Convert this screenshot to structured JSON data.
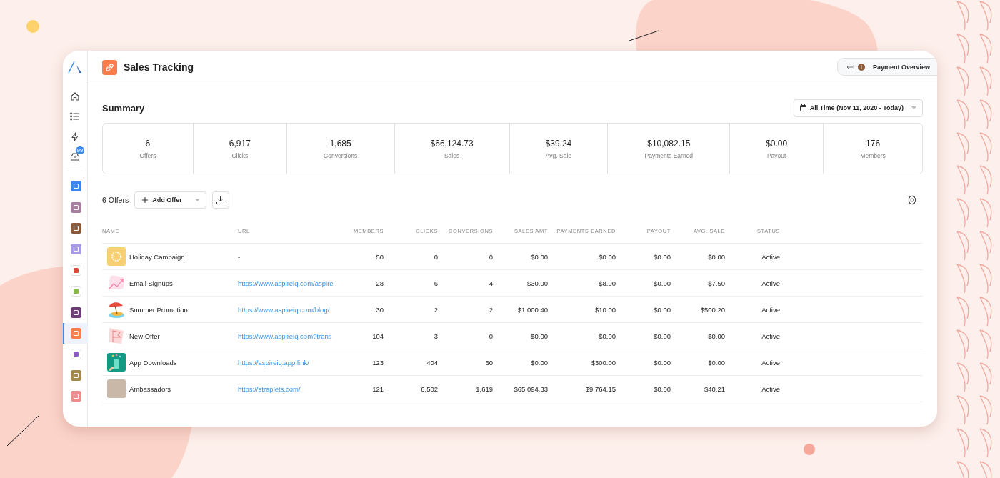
{
  "sidebar": {
    "nav": [
      {
        "kind": "home",
        "selected": false
      },
      {
        "kind": "list",
        "selected": false
      },
      {
        "kind": "bolt",
        "selected": false
      },
      {
        "kind": "inbox",
        "selected": false,
        "badge": "99"
      }
    ],
    "apps": [
      {
        "kind": "filled",
        "color": "#3d86f0",
        "selected": false
      },
      {
        "kind": "filled",
        "color": "#a77e9f",
        "selected": false
      },
      {
        "kind": "filled",
        "color": "#8a5a3b",
        "selected": false
      },
      {
        "kind": "filled",
        "color": "#a99ae8",
        "selected": false
      },
      {
        "kind": "outlined",
        "color": "#e0463a",
        "selected": false
      },
      {
        "kind": "outlined",
        "color": "#86b94a",
        "selected": false
      },
      {
        "kind": "filled",
        "color": "#6d3a78",
        "selected": false
      },
      {
        "kind": "filled",
        "color": "#fa7b4c",
        "selected": true
      },
      {
        "kind": "outlined",
        "color": "#8a5cc4",
        "selected": false
      },
      {
        "kind": "filled",
        "color": "#a4894b",
        "selected": false
      },
      {
        "kind": "filled",
        "color": "#ec8c8c",
        "selected": false
      }
    ]
  },
  "header": {
    "title": "Sales Tracking",
    "payment_button": "Payment Overview"
  },
  "summary": {
    "title": "Summary",
    "date_range": "All Time (Nov 11, 2020 - Today)",
    "stats": [
      {
        "value": "6",
        "label": "Offers"
      },
      {
        "value": "6,917",
        "label": "Clicks"
      },
      {
        "value": "1,685",
        "label": "Conversions"
      },
      {
        "value": "$66,124.73",
        "label": "Sales"
      },
      {
        "value": "$39.24",
        "label": "Avg. Sale"
      },
      {
        "value": "$10,082.15",
        "label": "Payments Earned"
      },
      {
        "value": "$0.00",
        "label": "Payout"
      },
      {
        "value": "176",
        "label": "Members"
      }
    ]
  },
  "toolbar": {
    "count": "6 Offers",
    "add_button": "Add Offer"
  },
  "table": {
    "columns": [
      "NAME",
      "URL",
      "MEMBERS",
      "CLICKS",
      "CONVERSIONS",
      "SALES AMT",
      "PAYMENTS EARNED",
      "PAYOUT",
      "AVG. SALE",
      "STATUS"
    ],
    "rows": [
      {
        "kind": "sun",
        "name": "Holiday Campaign",
        "url": "-",
        "link": false,
        "members": "50",
        "clicks": "0",
        "conversions": "0",
        "sales_amt": "$0.00",
        "payments_earned": "$0.00",
        "payout": "$0.00",
        "avg_sale": "$0.00",
        "status": "Active"
      },
      {
        "kind": "chart",
        "name": "Email Signups",
        "url": "https://www.aspireiq.com/aspire",
        "link": true,
        "members": "28",
        "clicks": "6",
        "conversions": "4",
        "sales_amt": "$30.00",
        "payments_earned": "$8.00",
        "payout": "$0.00",
        "avg_sale": "$7.50",
        "status": "Active"
      },
      {
        "kind": "beach",
        "name": "Summer Promotion",
        "url": "https://www.aspireiq.com/blog/",
        "link": true,
        "members": "30",
        "clicks": "2",
        "conversions": "2",
        "sales_amt": "$1,000.40",
        "payments_earned": "$10.00",
        "payout": "$0.00",
        "avg_sale": "$500.20",
        "status": "Active"
      },
      {
        "kind": "flag",
        "name": "New Offer",
        "url": "https://www.aspireiq.com?trans",
        "link": true,
        "members": "104",
        "clicks": "3",
        "conversions": "0",
        "sales_amt": "$0.00",
        "payments_earned": "$0.00",
        "payout": "$0.00",
        "avg_sale": "$0.00",
        "status": "Active"
      },
      {
        "kind": "phone",
        "name": "App Downloads",
        "url": "https://aspireiq.app.link/",
        "link": true,
        "members": "123",
        "clicks": "404",
        "conversions": "60",
        "sales_amt": "$0.00",
        "payments_earned": "$300.00",
        "payout": "$0.00",
        "avg_sale": "$0.00",
        "status": "Active"
      },
      {
        "kind": "photo",
        "name": "Ambassadors",
        "url": "https://straplets.com/",
        "link": true,
        "members": "121",
        "clicks": "6,502",
        "conversions": "1,619",
        "sales_amt": "$65,094.33",
        "payments_earned": "$9,764.15",
        "payout": "$0.00",
        "avg_sale": "$40.21",
        "status": "Active"
      }
    ]
  }
}
